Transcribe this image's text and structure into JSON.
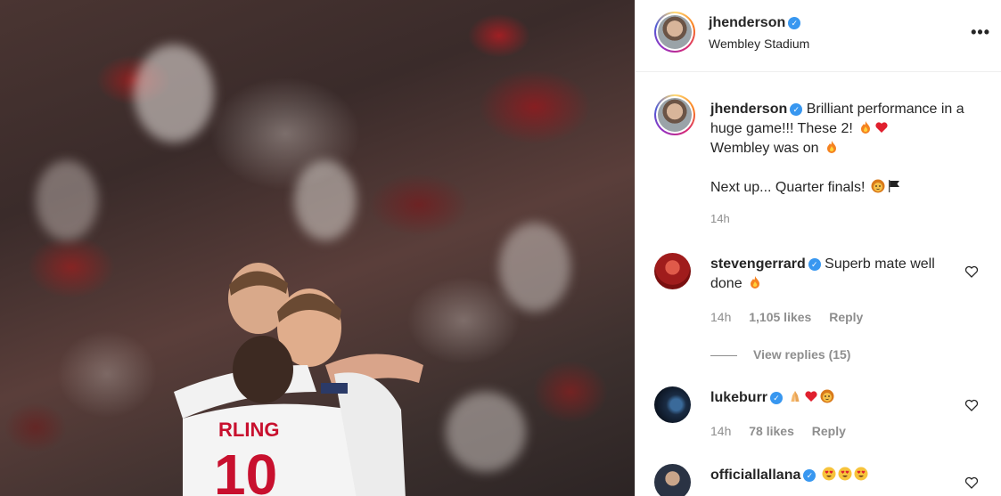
{
  "post": {
    "username": "jhenderson",
    "location": "Wembley Stadium",
    "caption_line1": "Brilliant performance in a huge game!!! These 2!",
    "caption_line2": "Wembley was on",
    "caption_line3": "Next up... Quarter finals!",
    "time": "14h"
  },
  "comments": [
    {
      "username": "stevengerrard",
      "text": "Superb mate well done",
      "time": "14h",
      "likes": "1,105 likes",
      "reply": "Reply",
      "view_replies": "View replies (15)"
    },
    {
      "username": "lukeburr",
      "text": "",
      "time": "14h",
      "likes": "78 likes",
      "reply": "Reply"
    },
    {
      "username": "officiallallana",
      "text": ""
    }
  ],
  "icons": {
    "more": "more-icon",
    "verified": "verified-badge-icon",
    "like": "heart-outline-icon"
  },
  "colors": {
    "verified": "#3897f0",
    "muted": "#8e8e8e",
    "text": "#262626"
  }
}
